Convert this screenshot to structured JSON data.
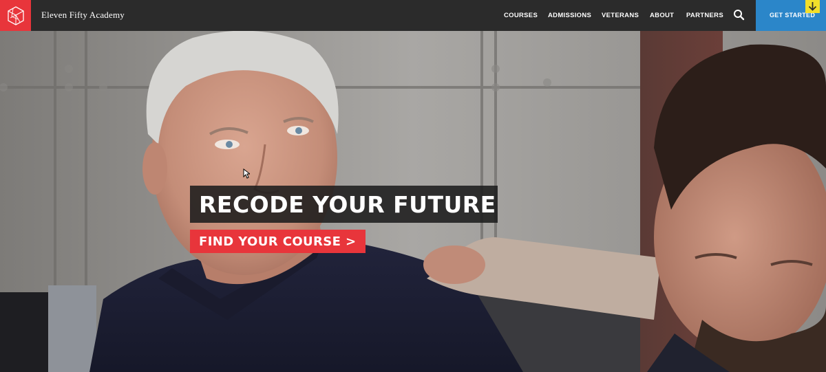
{
  "brand": {
    "name": "Eleven Fifty Academy"
  },
  "nav": {
    "items": [
      {
        "label": "COURSES"
      },
      {
        "label": "ADMISSIONS"
      },
      {
        "label": "VETERANS"
      },
      {
        "label": "ABOUT"
      },
      {
        "label": "PARTNERS"
      }
    ],
    "search_icon": "search-icon",
    "cta_label": "GET STARTED",
    "cta_arrow_icon": "arrow-down-icon"
  },
  "hero": {
    "headline": "RECODE YOUR FUTURE",
    "button_label": "FIND YOUR COURSE >"
  },
  "colors": {
    "nav_bg": "#2b2b2b",
    "brand_red": "#e8353b",
    "cta_blue": "#2b86c9",
    "arrow_yellow": "#f2df2a"
  }
}
